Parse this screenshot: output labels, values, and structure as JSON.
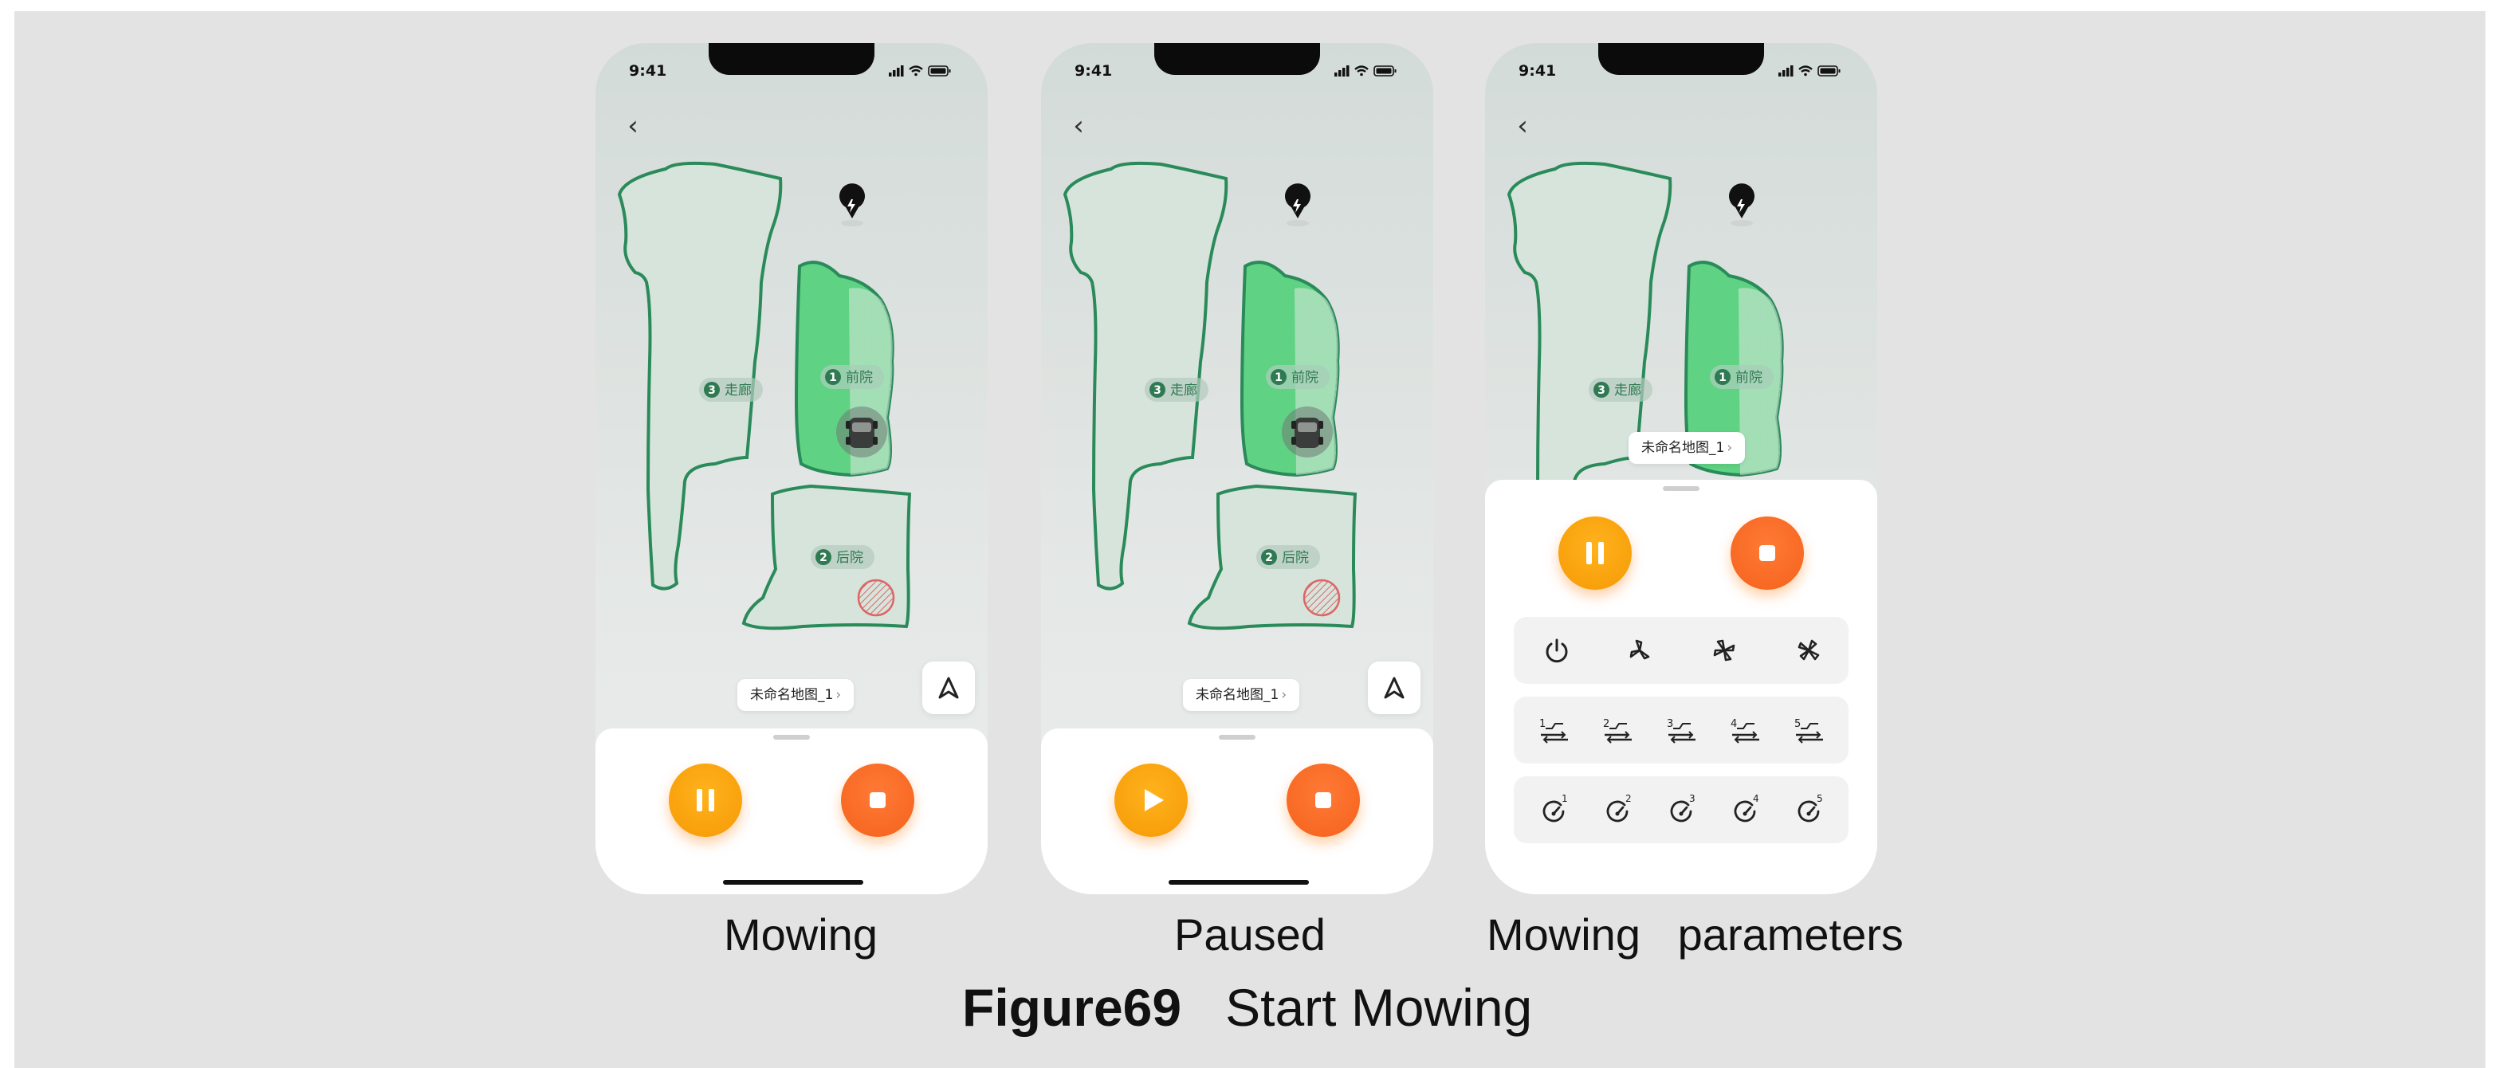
{
  "status": {
    "time": "9:41"
  },
  "map": {
    "name": "未命名地图_1",
    "zones": [
      {
        "number": "1",
        "label": "前院"
      },
      {
        "number": "2",
        "label": "后院"
      },
      {
        "number": "3",
        "label": "走廊"
      }
    ]
  },
  "captions": {
    "mowing": "Mowing",
    "paused": "Paused",
    "parameters_1": "Mowing",
    "parameters_2": "parameters"
  },
  "figure": {
    "number": "Figure69",
    "title": "Start Mowing"
  },
  "parameters": {
    "cutting_modes": [
      "power-icon",
      "blade-mode-1-icon",
      "blade-mode-2-icon",
      "blade-mode-3-icon"
    ],
    "height_levels": [
      "1",
      "2",
      "3",
      "4",
      "5"
    ],
    "speed_levels": [
      "1",
      "2",
      "3",
      "4",
      "5"
    ]
  },
  "colors": {
    "zone_stroke": "#2a8a5a",
    "zone_fill": "#d8e6de",
    "mowed_fill": "#5fd283",
    "pause_button": "#f8a00b",
    "stop_button": "#f56a24",
    "background": "#e3e3e3"
  }
}
